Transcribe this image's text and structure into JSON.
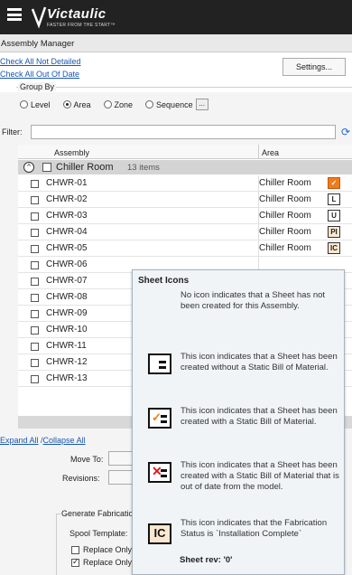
{
  "app": {
    "logo_text": "Victaulic",
    "logo_tagline": "FASTER FROM THE START™",
    "window_title": "Assembly Manager"
  },
  "actions": {
    "check_all_not_detailed": "Check All Not Detailed",
    "check_all_out_of_date": "Check All Out Of Date",
    "settings_button": "Settings..."
  },
  "group_by": {
    "label": "Group By",
    "options": [
      "Level",
      "Area",
      "Zone",
      "Sequence"
    ],
    "selected": "Area",
    "more_button": "..."
  },
  "filter": {
    "label": "Filter:",
    "value": ""
  },
  "grid": {
    "columns": [
      "Assembly",
      "Area"
    ],
    "group": {
      "name": "Chiller Room",
      "count": "13 items",
      "collapse_symbol": "^"
    },
    "rows": [
      {
        "name": "CHWR-01",
        "area": "Chiller Room",
        "icon": "✓"
      },
      {
        "name": "CHWR-02",
        "area": "Chiller Room",
        "icon": "L"
      },
      {
        "name": "CHWR-03",
        "area": "Chiller Room",
        "icon": "U"
      },
      {
        "name": "CHWR-04",
        "area": "Chiller Room",
        "icon": "PI"
      },
      {
        "name": "CHWR-05",
        "area": "Chiller Room",
        "icon": "IC"
      },
      {
        "name": "CHWR-06",
        "area": "",
        "icon": ""
      },
      {
        "name": "CHWR-07",
        "area": "",
        "icon": ""
      },
      {
        "name": "CHWR-08",
        "area": "",
        "icon": ""
      },
      {
        "name": "CHWR-09",
        "area": "",
        "icon": ""
      },
      {
        "name": "CHWR-10",
        "area": "",
        "icon": ""
      },
      {
        "name": "CHWR-11",
        "area": "",
        "icon": ""
      },
      {
        "name": "CHWR-12",
        "area": "",
        "icon": ""
      },
      {
        "name": "CHWR-13",
        "area": "",
        "icon": ""
      }
    ]
  },
  "bottom": {
    "expand_all": "Expand All",
    "separator": " /",
    "collapse_all": "Collapse All",
    "move_to_label": "Move To:",
    "revisions_label": "Revisions:",
    "generate_fabrication": "Generate Fabrication",
    "spool_template_label": "Spool Template:",
    "replace_only_1": "Replace Only",
    "replace_only_2": "Replace Only"
  },
  "tooltip": {
    "title": "Sheet Icons",
    "items": [
      {
        "icon": "none",
        "text": "No icon indicates that a Sheet has not been created for this Assembly."
      },
      {
        "icon": "sheet",
        "text": "This icon indicates that a Sheet has been created without a Static Bill of Material."
      },
      {
        "icon": "sheet-check",
        "text": "This icon indicates that a Sheet has been created with a Static Bill of Material."
      },
      {
        "icon": "sheet-x",
        "text": "This icon indicates that a Sheet has been created with a Static Bill of Material that is out of date from the model."
      },
      {
        "icon": "ic",
        "icon_text": "IC",
        "text": "This icon indicates that the Fabrication Status is `Installation Complete`"
      }
    ],
    "sheet_rev": "Sheet rev: '0'"
  },
  "colors": {
    "topbar": "#222222",
    "link": "#1a56b0",
    "status_orange": "#f07c1a",
    "status_cream": "#fbe7cf",
    "out_of_date_red": "#e01a1a",
    "tooltip_bg": "#f0f4f7"
  }
}
